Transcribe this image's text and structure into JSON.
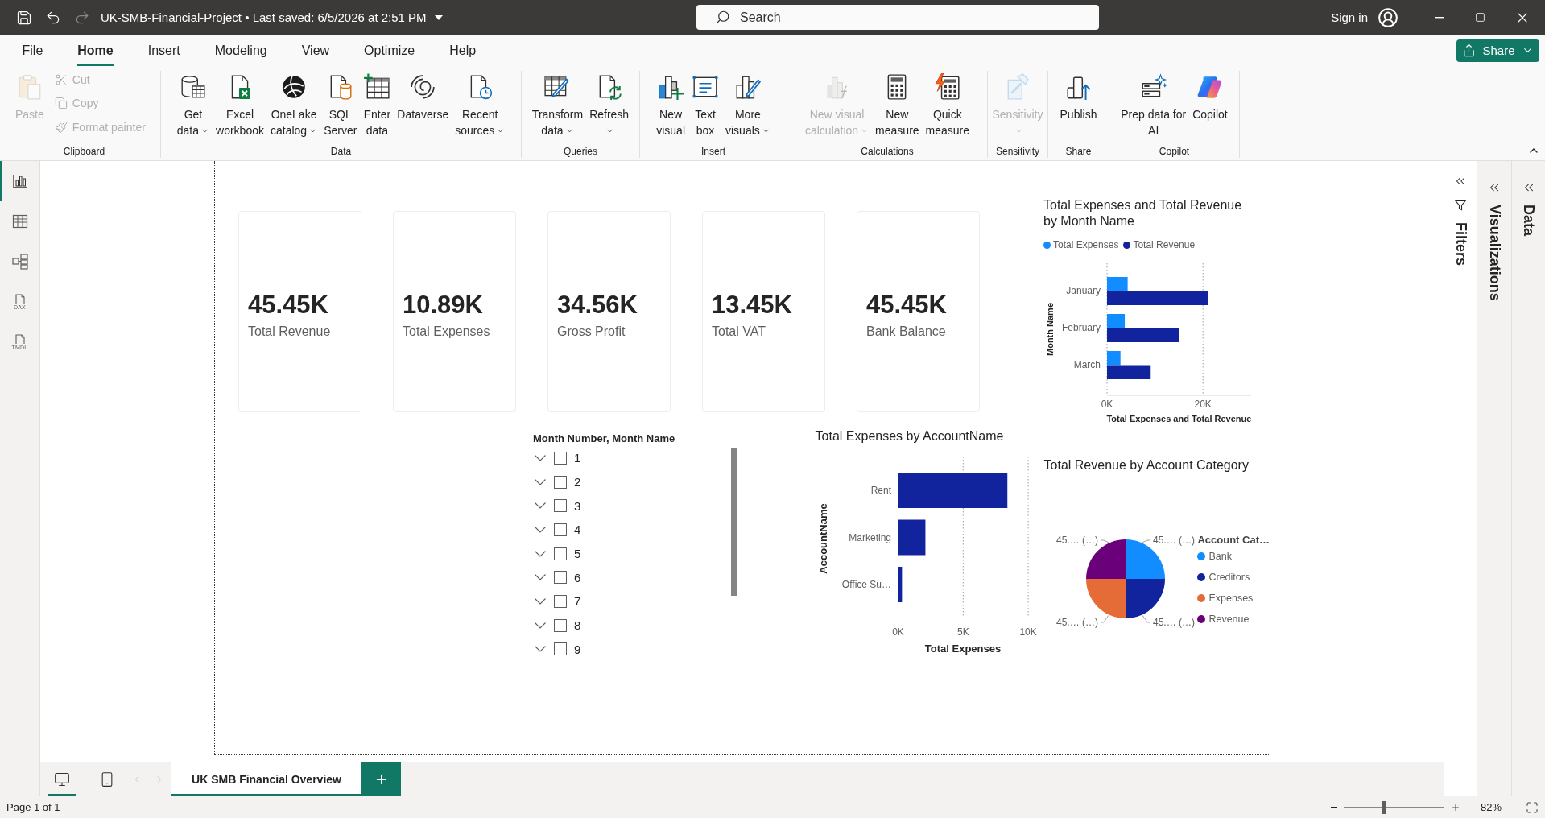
{
  "title_bar": {
    "quick_access": [
      {
        "kind": "save",
        "disabled": false
      },
      {
        "kind": "undo",
        "disabled": false
      },
      {
        "kind": "redo",
        "disabled": true
      }
    ],
    "title": "UK-SMB-Financial-Project • Last saved: 6/5/2026 at 2:51 PM",
    "search": {
      "placeholder": "Search"
    },
    "sign_in": "Sign in"
  },
  "menu_tabs": [
    {
      "label": "File",
      "selected": false
    },
    {
      "label": "Home",
      "selected": true
    },
    {
      "label": "Insert",
      "selected": false
    },
    {
      "label": "Modeling",
      "selected": false
    },
    {
      "label": "View",
      "selected": false
    },
    {
      "label": "Optimize",
      "selected": false
    },
    {
      "label": "Help",
      "selected": false
    }
  ],
  "share_button": {
    "label": "Share"
  },
  "ribbon": [
    {
      "label": "Clipboard",
      "items": [
        {
          "kind": "large",
          "lines": [
            "Paste"
          ],
          "dropdown": false,
          "disabled": true
        },
        {
          "kind": "small",
          "lines": [
            "Cut"
          ],
          "dropdown": false,
          "disabled": true
        },
        {
          "kind": "small",
          "lines": [
            "Copy"
          ],
          "dropdown": false,
          "disabled": true
        },
        {
          "kind": "small",
          "lines": [
            "Format painter"
          ],
          "dropdown": false,
          "disabled": true
        }
      ]
    },
    {
      "label": "Data",
      "items": [
        {
          "kind": "large",
          "lines": [
            "Get",
            "data"
          ],
          "dropdown": true,
          "disabled": false
        },
        {
          "kind": "large",
          "lines": [
            "Excel",
            "workbook"
          ],
          "dropdown": false,
          "disabled": false
        },
        {
          "kind": "large",
          "lines": [
            "OneLake",
            "catalog"
          ],
          "dropdown": true,
          "disabled": false
        },
        {
          "kind": "large",
          "lines": [
            "SQL",
            "Server"
          ],
          "dropdown": false,
          "disabled": false
        },
        {
          "kind": "large",
          "lines": [
            "Enter",
            "data"
          ],
          "dropdown": false,
          "disabled": false
        },
        {
          "kind": "large",
          "lines": [
            "Dataverse"
          ],
          "dropdown": false,
          "disabled": false
        },
        {
          "kind": "large",
          "lines": [
            "Recent",
            "sources"
          ],
          "dropdown": true,
          "disabled": false
        }
      ]
    },
    {
      "label": "Queries",
      "items": [
        {
          "kind": "large",
          "lines": [
            "Transform",
            "data"
          ],
          "dropdown": true,
          "disabled": false
        },
        {
          "kind": "large",
          "lines": [
            "Refresh"
          ],
          "dropdown": true,
          "disabled": false
        }
      ]
    },
    {
      "label": "Insert",
      "items": [
        {
          "kind": "large",
          "lines": [
            "New",
            "visual"
          ],
          "dropdown": false,
          "disabled": false
        },
        {
          "kind": "large",
          "lines": [
            "Text",
            "box"
          ],
          "dropdown": false,
          "disabled": false
        },
        {
          "kind": "large",
          "lines": [
            "More",
            "visuals"
          ],
          "dropdown": true,
          "disabled": false
        }
      ]
    },
    {
      "label": "Calculations",
      "items": [
        {
          "kind": "large",
          "lines": [
            "New visual",
            "calculation"
          ],
          "dropdown": true,
          "disabled": true
        },
        {
          "kind": "large",
          "lines": [
            "New",
            "measure"
          ],
          "dropdown": false,
          "disabled": false
        },
        {
          "kind": "large",
          "lines": [
            "Quick",
            "measure"
          ],
          "dropdown": false,
          "disabled": false
        }
      ]
    },
    {
      "label": "Sensitivity",
      "items": [
        {
          "kind": "large",
          "lines": [
            "Sensitivity"
          ],
          "dropdown": true,
          "disabled": true
        }
      ]
    },
    {
      "label": "Share",
      "items": [
        {
          "kind": "large",
          "lines": [
            "Publish"
          ],
          "dropdown": false,
          "disabled": false
        }
      ]
    },
    {
      "label": "Copilot",
      "items": [
        {
          "kind": "large",
          "lines": [
            "Prep data for",
            "AI"
          ],
          "dropdown": false,
          "disabled": false
        },
        {
          "kind": "large",
          "lines": [
            "Copilot"
          ],
          "dropdown": false,
          "disabled": false
        }
      ]
    }
  ],
  "nav_rail": [
    {
      "selected": true
    },
    {
      "selected": false
    },
    {
      "selected": false
    },
    {
      "label": "DAX",
      "selected": false
    },
    {
      "label": "TMDL",
      "selected": false
    }
  ],
  "report": {
    "cards": [
      {
        "value": "45.45K",
        "label": "Total Revenue"
      },
      {
        "value": "10.89K",
        "label": "Total Expenses"
      },
      {
        "value": "34.56K",
        "label": "Gross Profit"
      },
      {
        "value": "13.45K",
        "label": "Total VAT"
      },
      {
        "value": "45.45K",
        "label": "Bank Balance"
      }
    ],
    "expenses_revenue_by_month": {
      "chart_data": {
        "type": "bar",
        "orientation": "horizontal",
        "title": "Total Expenses and Total Revenue by Month Name",
        "xlabel": "Total Expenses and Total Revenue",
        "ylabel": "Month Name",
        "categories": [
          "January",
          "February",
          "March"
        ],
        "series": [
          {
            "name": "Total Expenses",
            "color": "#118dff",
            "values": [
              4300,
              3700,
              2800
            ]
          },
          {
            "name": "Total Revenue",
            "color": "#12239e",
            "values": [
              21000,
              15000,
              9100
            ]
          }
        ],
        "xlim": [
          0,
          30000
        ],
        "xticks": [
          {
            "value": 0,
            "label": "0K"
          },
          {
            "value": 20000,
            "label": "20K"
          }
        ],
        "legend": "top",
        "grid": true
      }
    },
    "month_slicer": {
      "title": "Month Number, Month Name",
      "items": [
        {
          "label": "1",
          "expanded": false,
          "checked": false
        },
        {
          "label": "2",
          "expanded": false,
          "checked": false
        },
        {
          "label": "3",
          "expanded": false,
          "checked": false
        },
        {
          "label": "4",
          "expanded": false,
          "checked": false
        },
        {
          "label": "5",
          "expanded": false,
          "checked": false
        },
        {
          "label": "6",
          "expanded": false,
          "checked": false
        },
        {
          "label": "7",
          "expanded": false,
          "checked": false
        },
        {
          "label": "8",
          "expanded": false,
          "checked": false
        },
        {
          "label": "9",
          "expanded": false,
          "checked": false
        }
      ]
    },
    "expenses_by_account": {
      "chart_data": {
        "type": "bar",
        "orientation": "horizontal",
        "title": "Total Expenses by AccountName",
        "xlabel": "Total Expenses",
        "ylabel": "AccountName",
        "categories": [
          "Rent",
          "Marketing",
          "Office Su…"
        ],
        "values": [
          8400,
          2100,
          300
        ],
        "color": "#12239e",
        "xlim": [
          0,
          10000
        ],
        "xticks": [
          {
            "value": 0,
            "label": "0K"
          },
          {
            "value": 5000,
            "label": "5K"
          },
          {
            "value": 10000,
            "label": "10K"
          }
        ],
        "grid": true
      }
    },
    "revenue_by_category": {
      "chart_data": {
        "type": "pie",
        "title": "Total Revenue by Account Category",
        "legend_title": "Account Cat…",
        "legend": "right",
        "categories": [
          "Bank",
          "Creditors",
          "Expenses",
          "Revenue"
        ],
        "values": [
          45,
          45,
          45,
          45
        ],
        "colors": [
          "#118dff",
          "#12239e",
          "#e66c37",
          "#6b007b"
        ],
        "value_labels": [
          "45.… (…)",
          "45.… (…)",
          "45.… (…)",
          "45.… (…)"
        ]
      }
    }
  },
  "side_panes": [
    {
      "kind": "filters",
      "label": "Filters"
    },
    {
      "kind": "visualizations",
      "label": "Visualizations"
    },
    {
      "kind": "data",
      "label": "Data"
    }
  ],
  "page_tabs": {
    "views": [
      {
        "kind": "desktop",
        "selected": true
      },
      {
        "kind": "mobile",
        "selected": false
      }
    ],
    "scroll_buttons": [
      {
        "kind": "previous",
        "disabled": true
      },
      {
        "kind": "next",
        "disabled": true
      }
    ],
    "pages": [
      {
        "label": "UK SMB Financial Overview",
        "selected": true
      }
    ]
  },
  "status_bar": {
    "page_info": "Page 1 of 1",
    "zoom": {
      "level": 0.4,
      "reading": "82%"
    }
  }
}
